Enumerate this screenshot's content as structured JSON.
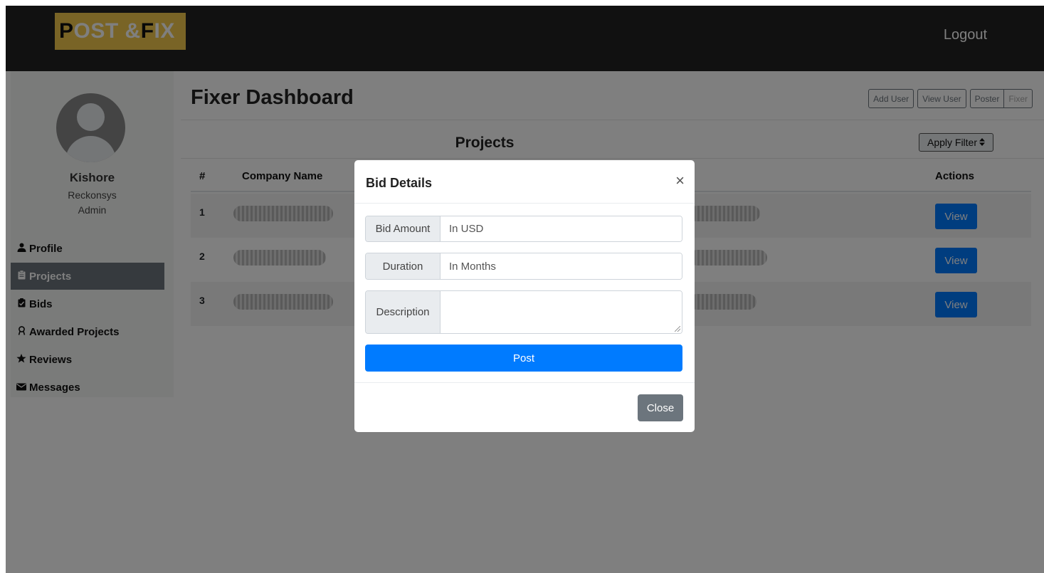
{
  "navbar": {
    "logo_part1": "P",
    "logo_part2": "OST & ",
    "logo_part3": "F",
    "logo_part4": "IX",
    "logout_label": "Logout"
  },
  "sidebar": {
    "user_name": "Kishore",
    "user_org": "Reckonsys",
    "user_role": "Admin",
    "items": [
      {
        "label": "Profile",
        "icon": "user-icon"
      },
      {
        "label": "Projects",
        "icon": "clipboard-icon",
        "active": true
      },
      {
        "label": "Bids",
        "icon": "clipboard-check-icon"
      },
      {
        "label": "Awarded Projects",
        "icon": "award-icon"
      },
      {
        "label": "Reviews",
        "icon": "star-icon"
      },
      {
        "label": "Messages",
        "icon": "envelope-icon"
      }
    ]
  },
  "header": {
    "title": "Fixer Dashboard",
    "buttons": {
      "add_user": "Add User",
      "view_user": "View User",
      "poster": "Poster",
      "fixer": "Fixer"
    }
  },
  "projects": {
    "title": "Projects",
    "filter_label": "Apply Filter",
    "columns": {
      "num": "#",
      "company": "Company Name",
      "actions": "Actions"
    },
    "rows": [
      {
        "num": "1",
        "action": "View"
      },
      {
        "num": "2",
        "action": "View"
      },
      {
        "num": "3",
        "action": "View"
      }
    ]
  },
  "modal": {
    "title": "Bid Details",
    "close_x": "×",
    "fields": {
      "bid_amount_label": "Bid Amount",
      "bid_amount_placeholder": "In USD",
      "duration_label": "Duration",
      "duration_placeholder": "In Months",
      "description_label": "Description"
    },
    "post_label": "Post",
    "close_label": "Close"
  },
  "colors": {
    "navbar_bg": "#222222",
    "logo_bg": "#f2c94c",
    "primary": "#007bff",
    "secondary": "#6c757d"
  }
}
